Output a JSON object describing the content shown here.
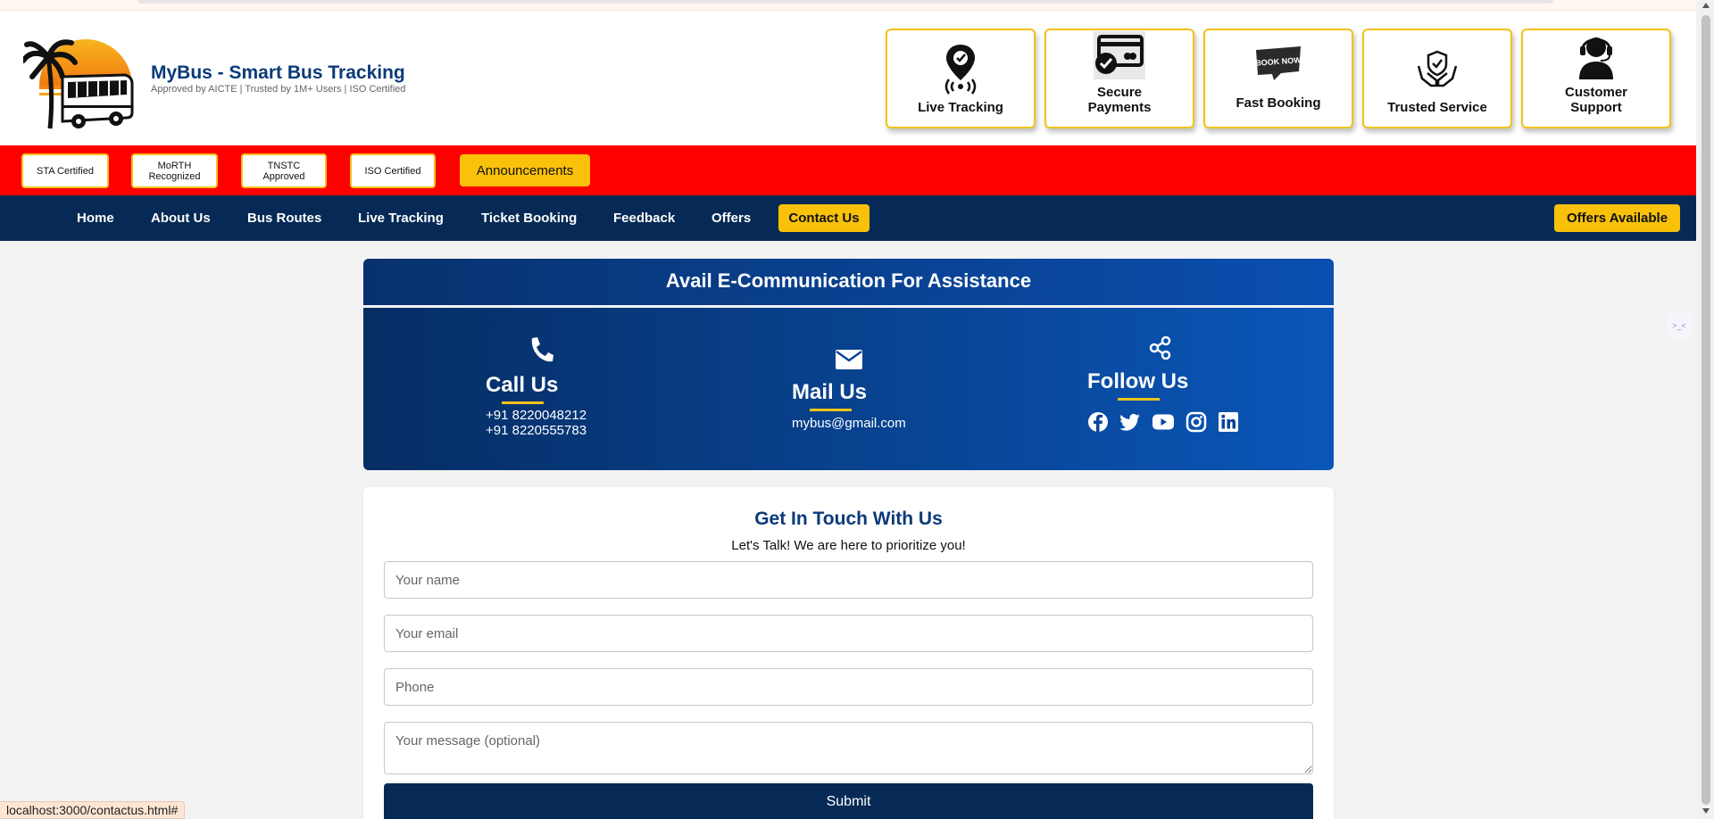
{
  "brand": {
    "title": "MyBus - Smart Bus Tracking",
    "subtitle": "Approved by AICTE | Trusted by 1M+ Users | ISO Certified",
    "logo_icon": "bus-palm-sunset-logo"
  },
  "features": [
    {
      "label": "Live Tracking",
      "icon": "location-pin-icon"
    },
    {
      "label": "Secure\nPayments",
      "icon": "credit-card-icon"
    },
    {
      "label": "Fast Booking",
      "icon": "book-now-tag-icon"
    },
    {
      "label": "Trusted Service",
      "icon": "shield-hands-icon"
    },
    {
      "label": "Customer\nSupport",
      "icon": "headset-icon"
    }
  ],
  "certifications": [
    "STA Certified",
    "MoRTH\nRecognized",
    "TNSTC\nApproved",
    "ISO Certified"
  ],
  "announcements_label": "Announcements",
  "nav": {
    "items": [
      "Home",
      "About Us",
      "Bus Routes",
      "Live Tracking",
      "Ticket Booking",
      "Feedback",
      "Offers"
    ],
    "active": "Contact Us",
    "offers_button": "Offers Available"
  },
  "ecomm": {
    "heading": "Avail E-Communication For Assistance",
    "call": {
      "title": "Call Us",
      "phone1": "+91 8220048212",
      "phone2": "+91 8220555783"
    },
    "mail": {
      "title": "Mail Us",
      "email": "mybus@gmail.com"
    },
    "follow": {
      "title": "Follow Us",
      "networks": [
        "facebook",
        "twitter",
        "youtube",
        "instagram",
        "linkedin"
      ]
    }
  },
  "form": {
    "title": "Get In Touch With Us",
    "subtitle": "Let's Talk! We are here to prioritize you!",
    "name_placeholder": "Your name",
    "email_placeholder": "Your email",
    "phone_placeholder": "Phone",
    "message_placeholder": "Your message (optional)",
    "submit_label": "Submit"
  },
  "status_url": "localhost:3000/contactus.html#",
  "colors": {
    "navy": "#062a55",
    "red": "#ff0000",
    "yellow": "#f9c10a",
    "brand_blue": "#0b3a78"
  }
}
